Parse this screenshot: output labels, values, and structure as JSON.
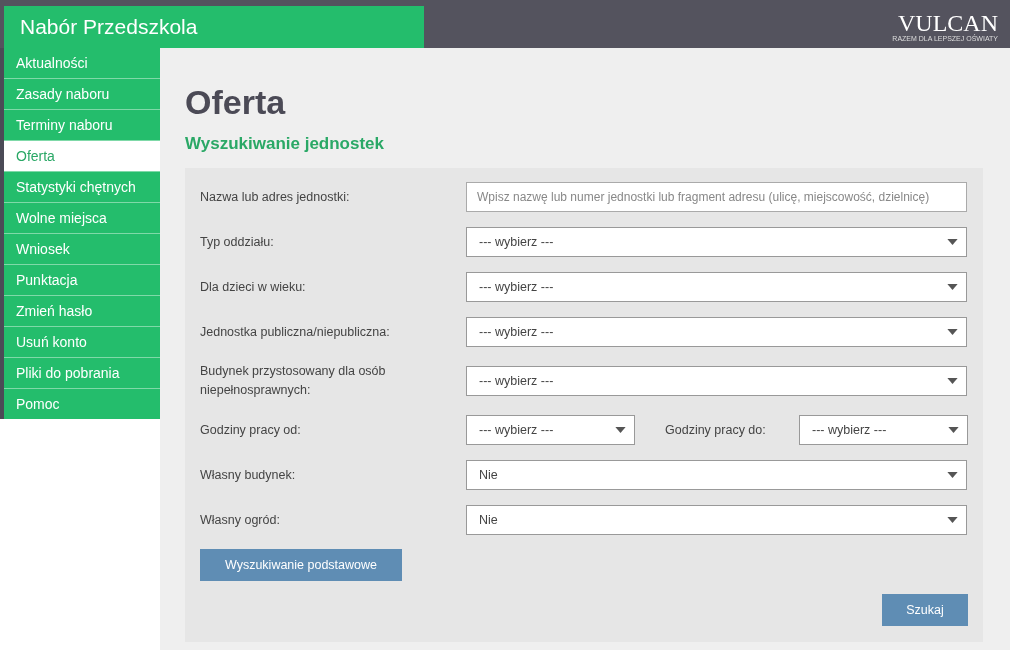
{
  "header": {
    "title": "Nabór Przedszkola",
    "logo": {
      "wordmark": "VULCAN",
      "tagline": "RAZEM DLA LEPSZEJ OŚWIATY"
    }
  },
  "sidebar": {
    "items": [
      {
        "label": "Aktualności",
        "selected": false
      },
      {
        "label": "Zasady naboru",
        "selected": false
      },
      {
        "label": "Terminy naboru",
        "selected": false
      },
      {
        "label": "Oferta",
        "selected": true
      },
      {
        "label": "Statystyki chętnych",
        "selected": false
      },
      {
        "label": "Wolne miejsca",
        "selected": false
      },
      {
        "label": "Wniosek",
        "selected": false
      },
      {
        "label": "Punktacja",
        "selected": false
      },
      {
        "label": "Zmień hasło",
        "selected": false
      },
      {
        "label": "Usuń konto",
        "selected": false
      },
      {
        "label": "Pliki do pobrania",
        "selected": false
      },
      {
        "label": "Pomoc",
        "selected": false
      }
    ]
  },
  "page": {
    "title": "Oferta",
    "subtitle": "Wyszukiwanie jednostek"
  },
  "form": {
    "rows": [
      {
        "kind": "text",
        "label": "Nazwa lub adres jednostki:",
        "placeholder": "Wpisz nazwę lub numer jednostki lub fragment adresu (ulicę, miejscowość, dzielnicę)"
      },
      {
        "kind": "select",
        "label": "Typ oddziału:",
        "value": "--- wybierz ---"
      },
      {
        "kind": "select",
        "label": "Dla dzieci w wieku:",
        "value": "--- wybierz ---"
      },
      {
        "kind": "select",
        "label": "Jednostka publiczna/niepubliczna:",
        "value": "--- wybierz ---"
      },
      {
        "kind": "select",
        "label": "Budynek przystosowany dla osób niepełnosprawnych:",
        "value": "--- wybierz ---"
      },
      {
        "kind": "pair",
        "label": "Godziny pracy od:",
        "value": "--- wybierz ---",
        "label_2": "Godziny pracy do:",
        "value_2": "--- wybierz ---"
      },
      {
        "kind": "select",
        "label": "Własny budynek:",
        "value": "Nie"
      },
      {
        "kind": "select",
        "label": "Własny ogród:",
        "value": "Nie"
      }
    ],
    "toggle_button": "Wyszukiwanie podstawowe",
    "search_button": "Szukaj"
  }
}
